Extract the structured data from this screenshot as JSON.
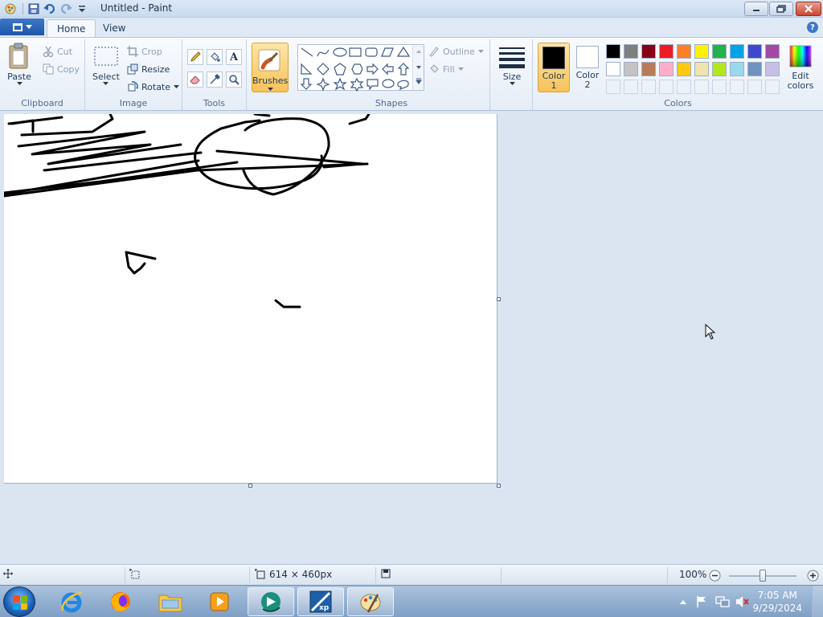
{
  "window": {
    "title": "Untitled - Paint",
    "controls": {
      "minimize": "minimize",
      "maximize": "restore",
      "close": "close"
    }
  },
  "quick_access": [
    "save-icon",
    "undo-icon",
    "redo-icon",
    "customize-dropdown-icon"
  ],
  "tabs": [
    {
      "label": "Home",
      "active": true
    },
    {
      "label": "View",
      "active": false
    }
  ],
  "ribbon": {
    "clipboard": {
      "group_label": "Clipboard",
      "paste_label": "Paste",
      "cut_label": "Cut",
      "copy_label": "Copy"
    },
    "image": {
      "group_label": "Image",
      "select_label": "Select",
      "crop_label": "Crop",
      "resize_label": "Resize",
      "rotate_label": "Rotate"
    },
    "tools": {
      "group_label": "Tools",
      "items": [
        "pencil-icon",
        "fill-icon",
        "text-icon",
        "eraser-icon",
        "color-picker-icon",
        "magnifier-icon"
      ],
      "text_glyph": "A"
    },
    "brushes_label": "Brushes",
    "shapes": {
      "group_label": "Shapes",
      "outline_label": "Outline",
      "fill_label": "Fill"
    },
    "size_label": "Size",
    "colors": {
      "group_label": "Colors",
      "color1_label": "Color",
      "color1_num": "1",
      "color2_label": "Color",
      "color2_num": "2",
      "color1_value": "#000000",
      "color2_value": "#ffffff",
      "edit_label": "Edit",
      "edit_label2": "colors",
      "palette_row1": [
        "#000000",
        "#7f7f7f",
        "#880015",
        "#ed1c24",
        "#ff7f27",
        "#fff200",
        "#22b14c",
        "#00a2e8",
        "#3f48cc",
        "#a349a4"
      ],
      "palette_row2": [
        "#ffffff",
        "#c3c3c3",
        "#b97a57",
        "#ffaec9",
        "#ffc90e",
        "#efe4b0",
        "#b5e61d",
        "#99d9ea",
        "#7092be",
        "#c8bfe7"
      ]
    }
  },
  "statusbar": {
    "canvas_size": "614 × 460px",
    "zoom": "100%"
  },
  "taskbar": {
    "apps": [
      "internet-explorer-icon",
      "firefox-icon",
      "file-explorer-icon",
      "media-player-icon",
      "pinned-app-icon",
      "xp-mode-icon",
      "paint-icon"
    ],
    "time": "7:05 AM",
    "date": "9/29/2024"
  }
}
